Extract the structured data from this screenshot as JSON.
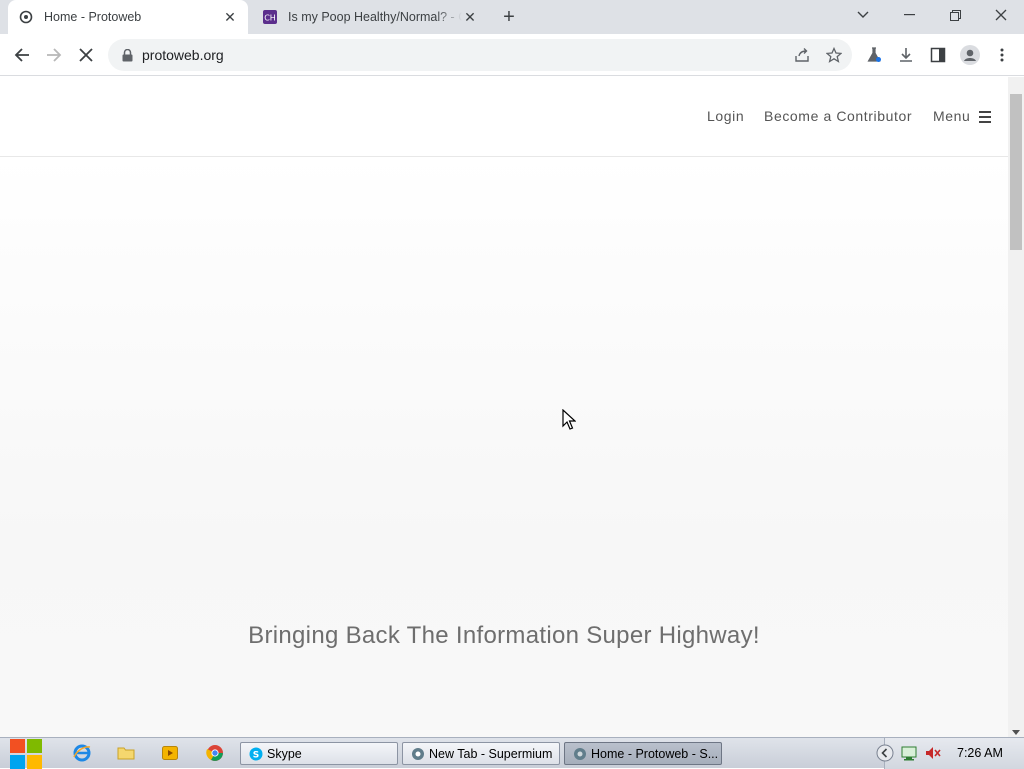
{
  "browser": {
    "tabs": [
      {
        "title": "Home - Protoweb",
        "active": true
      },
      {
        "title": "Is my Poop Healthy/Normal? - C",
        "active": false
      }
    ],
    "url": "protoweb.org"
  },
  "site": {
    "nav": {
      "login": "Login",
      "contributor": "Become a Contributor",
      "menu": "Menu"
    },
    "tagline": "Bringing Back The Information Super Highway!"
  },
  "taskbar": {
    "buttons": [
      {
        "label": "Skype",
        "active": false
      },
      {
        "label": "New Tab - Supermium",
        "active": false
      },
      {
        "label": "Home - Protoweb - S...",
        "active": true
      }
    ],
    "clock": "7:26 AM"
  },
  "colors": {
    "tabstrip": "#dee1e6",
    "omnibox": "#f1f3f4",
    "tagline": "#6e6e6e",
    "taskbar": "#c9ced8"
  },
  "icons": {
    "back": "arrow-left-icon",
    "forward": "arrow-right-icon",
    "stop": "stop-loading-icon",
    "lock": "lock-icon",
    "share": "share-icon",
    "bookmark": "star-icon",
    "extensions": "flask-icon",
    "download": "download-icon",
    "sidepanel": "side-panel-icon",
    "profile": "profile-icon",
    "kebab": "more-vertical-icon",
    "hamburger": "hamburger-icon"
  }
}
